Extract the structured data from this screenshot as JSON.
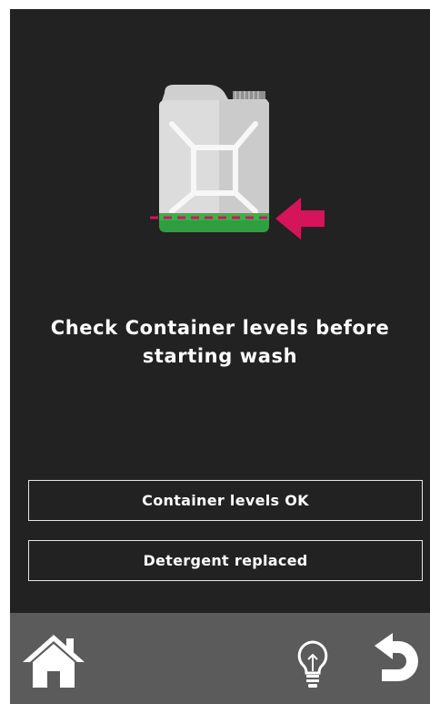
{
  "message": {
    "line1": "Check Container levels before",
    "line2": "starting wash"
  },
  "buttons": {
    "levels_ok": "Container levels OK",
    "detergent_replaced": "Detergent replaced"
  },
  "illustration": {
    "icon": "jerrycan-icon",
    "indicator_icon": "arrow-left-icon",
    "liquid_color": "#2e9f3e",
    "accent_color": "#d6145a"
  },
  "bottom_bar": {
    "home": "home-icon",
    "hint": "lightbulb-icon",
    "back": "back-arrow-icon"
  }
}
